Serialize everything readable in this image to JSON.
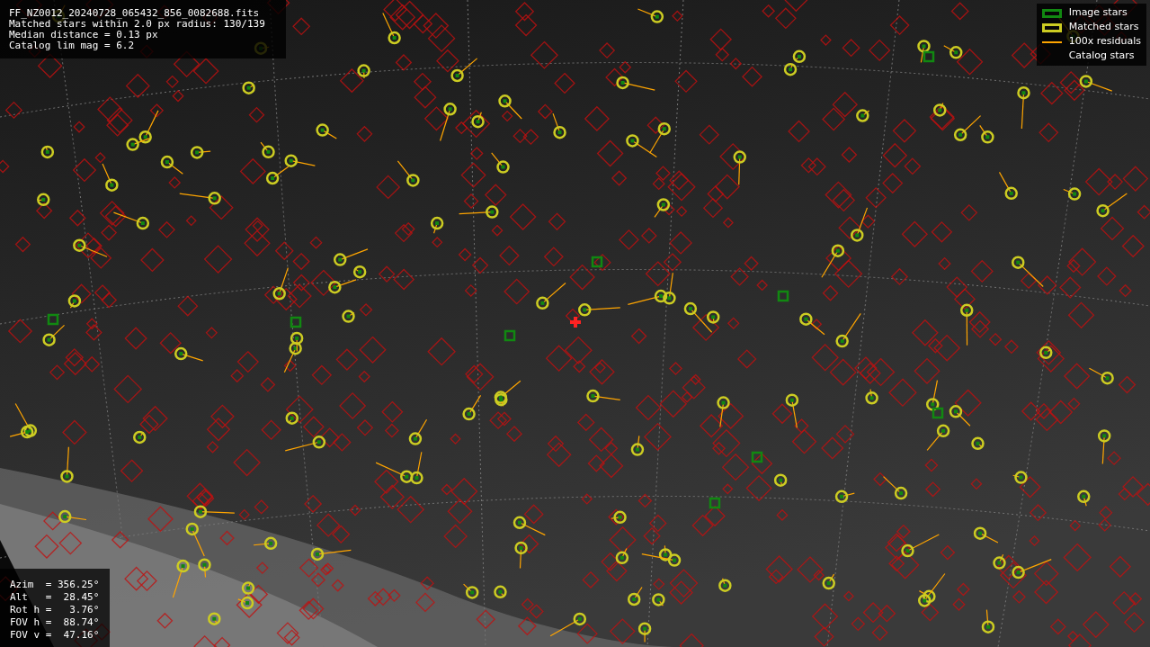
{
  "header": {
    "lines": [
      "FF_NZ0012_20240728_065432_856_0082688.fits",
      "Matched stars within 2.0 px radius: 130/139",
      "Median distance = 0.13 px",
      "Catalog lim mag = 6.2"
    ]
  },
  "legend": [
    {
      "kind": "box",
      "label": "Image stars",
      "color": "#118811"
    },
    {
      "kind": "box",
      "label": "Matched stars",
      "color": "#cccc22"
    },
    {
      "kind": "line",
      "label": "100x residuals",
      "color": "#ffa500"
    },
    {
      "kind": "none",
      "label": "Catalog stars"
    }
  ],
  "pointing": {
    "lines": [
      "Azim  = 356.25°",
      "Alt   =  28.45°",
      "Rot h =   3.76°",
      "FOV h =  88.74°",
      "FOV v =  47.16°"
    ]
  }
}
